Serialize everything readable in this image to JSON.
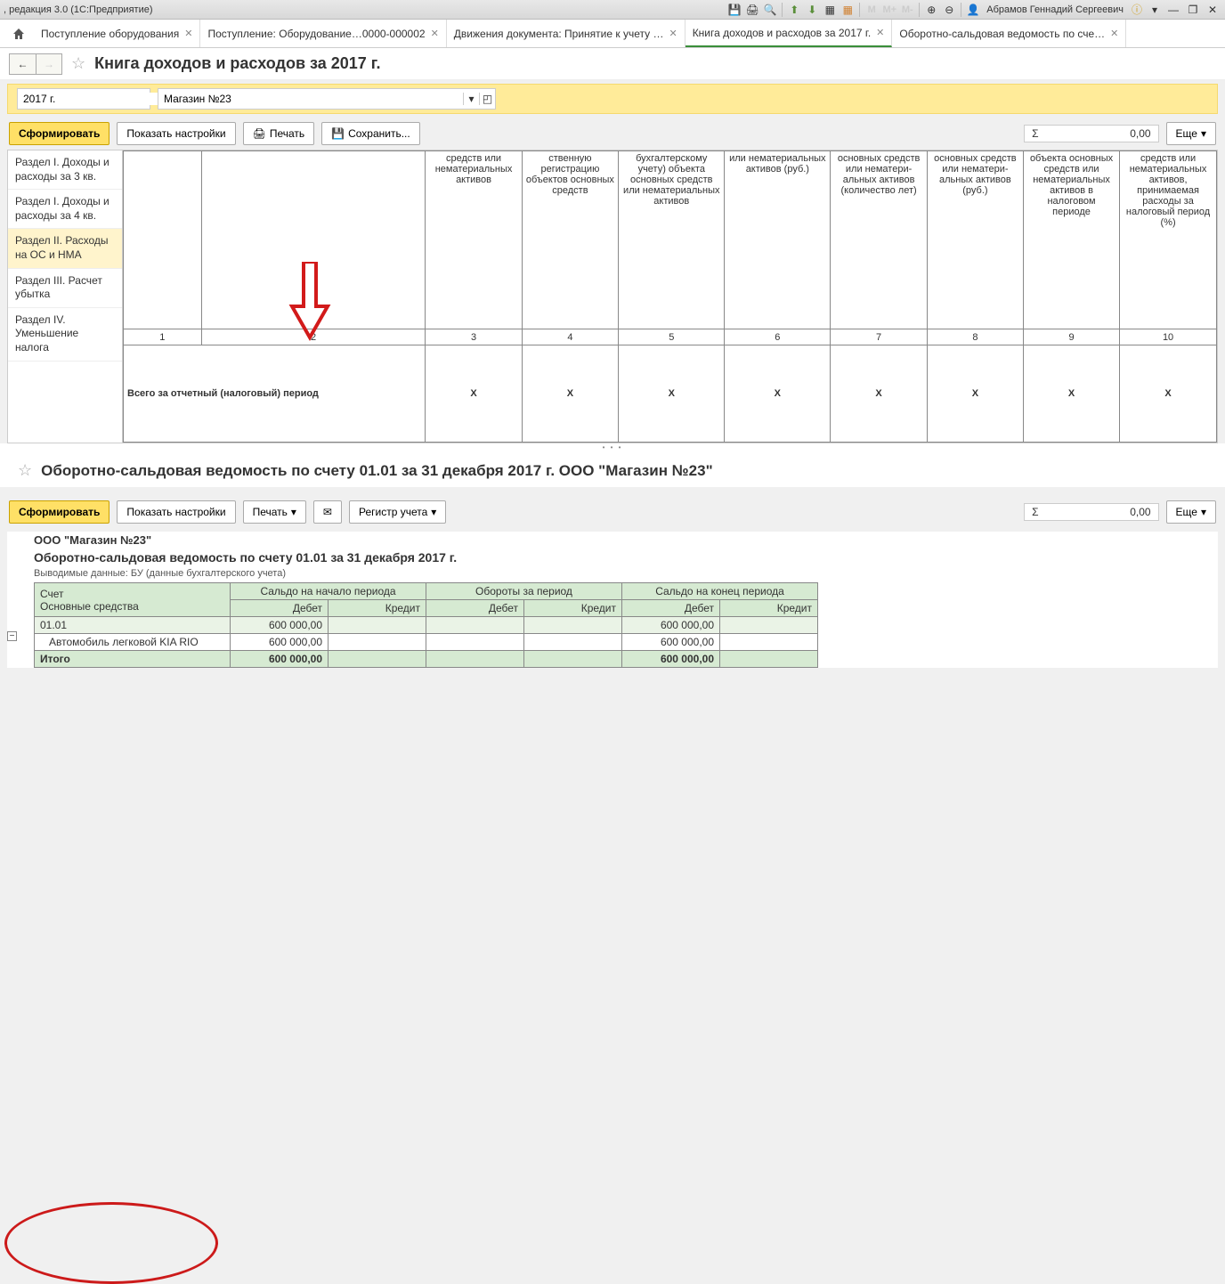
{
  "titlebar": {
    "title": ", редакция 3.0 (1С:Предприятие)",
    "user": "Абрамов Геннадий Сергеевич",
    "m_labels": [
      "M",
      "M+",
      "M-"
    ]
  },
  "tabs": {
    "items": [
      {
        "label": "Поступление оборудования"
      },
      {
        "label": "Поступление: Оборудование…0000-000002"
      },
      {
        "label": "Движения документа: Принятие к учету …"
      },
      {
        "label": "Книга доходов и расходов за 2017 г.",
        "active": true
      },
      {
        "label": "Оборотно-сальдовая ведомость по сче…"
      }
    ]
  },
  "page1": {
    "title": "Книга доходов и расходов за 2017 г.",
    "params": {
      "year": "2017 г.",
      "store": "Магазин №23"
    },
    "actions": {
      "form": "Сформировать",
      "show_settings": "Показать настройки",
      "print": "Печать",
      "save": "Сохранить...",
      "more": "Еще",
      "sum_val": "0,00"
    },
    "sidebar": [
      "Раздел I. Доходы и расходы за 3 кв.",
      "Раздел I. Доходы и расходы за 4 кв.",
      "Раздел II. Расходы на ОС и НМА",
      "Раздел III. Расчет убытка",
      "Раздел IV. Уменьшение налога"
    ],
    "table": {
      "headers": [
        "средств или нематери­альных активов",
        "ственную регистрацию объектов основных средств",
        "бухгалтерскому учету) объекта основных средств или нематериальных активов",
        "или нематериальных активов (руб.)",
        "основных средств или нематери­альных активов (количество лет)",
        "основных средств или нематери­альных активов (руб.)",
        "объекта основных средств или нематери­альных активов в налоговом периоде",
        "средств или нематери­альных активов, принимаемая расходы за налоговый период (%)"
      ],
      "colnums": [
        "1",
        "2",
        "3",
        "4",
        "5",
        "6",
        "7",
        "8",
        "9",
        "10"
      ],
      "sumrow_label": "Всего за отчетный  (налоговый) период",
      "x": "X"
    }
  },
  "page2": {
    "title": "Оборотно-сальдовая ведомость по счету 01.01 за 31 декабря 2017 г. ООО \"Магазин №23\"",
    "actions": {
      "form": "Сформировать",
      "show_settings": "Показать настройки",
      "print": "Печать",
      "register": "Регистр учета",
      "more": "Еще",
      "sum_val": "0,00"
    },
    "org": "ООО \"Магазин №23\"",
    "subtitle": "Оборотно-сальдовая ведомость по счету 01.01 за 31 декабря 2017 г.",
    "note": "Выводимые данные:   БУ (данные бухгалтерского учета)",
    "table": {
      "h_account": "Счет",
      "h_begin": "Сальдо на начало периода",
      "h_turn": "Обороты за период",
      "h_end": "Сальдо на конец периода",
      "h_debit": "Дебет",
      "h_credit": "Кредит",
      "h_os": "Основные средства",
      "rows": {
        "acct": "01.01",
        "asset": "Автомобиль легковой KIA RIO",
        "total": "Итого",
        "v1": "600 000,00",
        "v1b": "600 000,00"
      }
    }
  }
}
